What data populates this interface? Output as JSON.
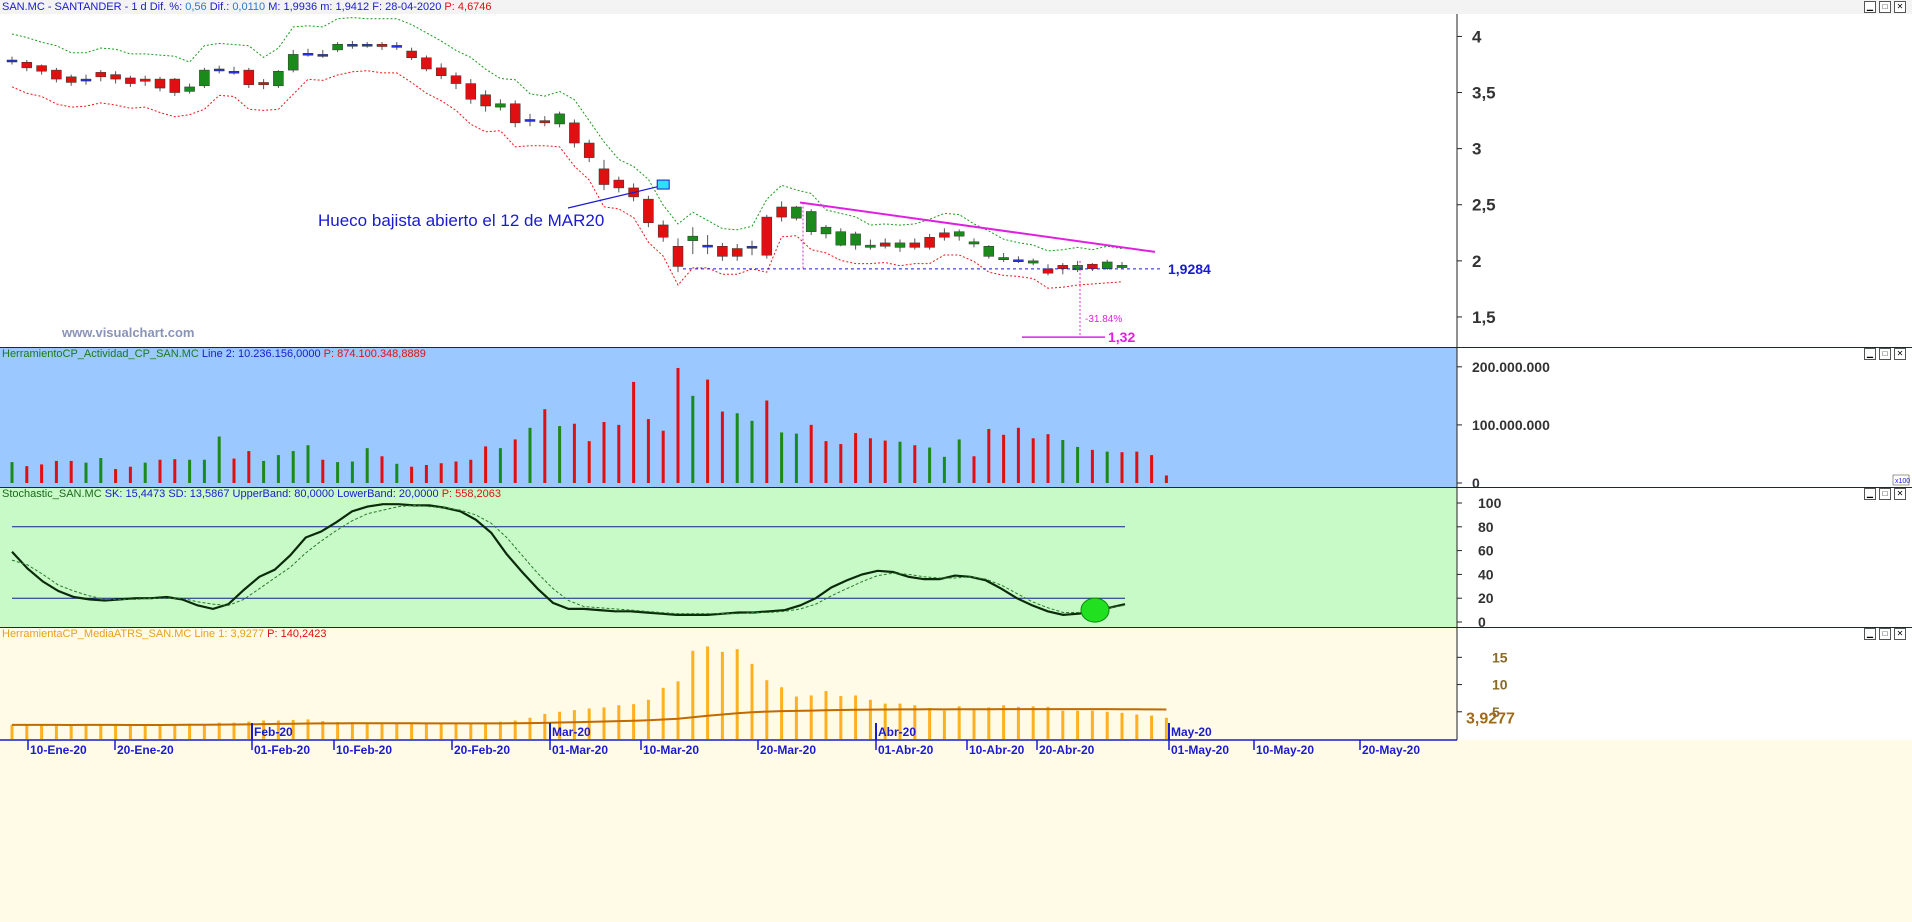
{
  "price_panel": {
    "ticker": "SAN.MC - SANTANDER -",
    "period": "1 d",
    "dif_pct_label": "Dif. %:",
    "dif_pct_value": "0,56",
    "dif_label": "Dif.:",
    "dif_value": "0,0110",
    "max_label": "M:",
    "max_value": "1,9936",
    "min_label": "m:",
    "min_value": "1,9412",
    "date_label": "F:",
    "date_value": "28-04-2020",
    "p_label": "P:",
    "p_value": "4,6746",
    "annotation": "Hueco bajista abierto el 12 de MAR20",
    "support_label": "1,9284",
    "target_label": "1,32",
    "drop_pct_label": "-31.84%",
    "watermark": "www.visualchart.com",
    "y_ticks": [
      "4",
      "3,5",
      "3",
      "2,5",
      "2",
      "1,5"
    ]
  },
  "volume_panel": {
    "title_name": "HerramientoCP_Actividad_CP_SAN.MC",
    "line_label": "Line 2:",
    "line_value": "10.236.156,0000",
    "p_text": "P: 874.100.348,8889",
    "y_ticks": [
      "200.000.000",
      "100.000.000",
      "0"
    ],
    "scale_tag": "x100"
  },
  "stoch_panel": {
    "title_name": "Stochastic_SAN.MC",
    "params": "SK: 15,4473  SD: 13,5867  UpperBand: 80,0000  LowerBand: 20,0000",
    "p_text": "P: 558,2063",
    "y_ticks": [
      "100",
      "80",
      "60",
      "40",
      "20",
      "0"
    ]
  },
  "atr_panel": {
    "title_name": "HerramientaCP_MediaATRS_SAN.MC",
    "params": "Line 1: 3,9277",
    "p_text": "P: 140,2423",
    "y_ticks": [
      "15",
      "10",
      "5"
    ],
    "value_label": "3,9277"
  },
  "x_axis": {
    "month_labels": [
      "Feb-20",
      "Mar-20",
      "Abr-20",
      "May-20"
    ],
    "date_labels": [
      "10-Ene-20",
      "20-Ene-20",
      "01-Feb-20",
      "10-Feb-20",
      "20-Feb-20",
      "01-Mar-20",
      "10-Mar-20",
      "20-Mar-20",
      "01-Abr-20",
      "10-Abr-20",
      "20-Abr-20",
      "01-May-20",
      "10-May-20",
      "20-May-20"
    ]
  },
  "colors": {
    "bull": "#1a8a1a",
    "bear": "#e01010",
    "neutral": "#2233dd",
    "channel_upper": "#1a9a1a",
    "channel_lower": "#e81818",
    "trendline": "#e020e0",
    "annotation": "#1a1ad0",
    "volume_bg": "#9ac8ff",
    "stoch_bg": "#c8fac8",
    "atr_bg": "#fffbe6",
    "atr_bar": "#ffb020",
    "atr_line": "#c06a00"
  },
  "chart_data": [
    {
      "type": "candlestick",
      "title": "SAN.MC - SANTANDER - 1 d",
      "ylim": [
        1.25,
        4.2
      ],
      "dates": [
        "2020-01-02",
        "2020-01-03",
        "2020-01-06",
        "2020-01-07",
        "2020-01-08",
        "2020-01-09",
        "2020-01-10",
        "2020-01-13",
        "2020-01-14",
        "2020-01-15",
        "2020-01-16",
        "2020-01-17",
        "2020-01-20",
        "2020-01-21",
        "2020-01-22",
        "2020-01-23",
        "2020-01-24",
        "2020-01-27",
        "2020-01-28",
        "2020-01-29",
        "2020-01-30",
        "2020-01-31",
        "2020-02-03",
        "2020-02-04",
        "2020-02-05",
        "2020-02-06",
        "2020-02-07",
        "2020-02-10",
        "2020-02-11",
        "2020-02-12",
        "2020-02-13",
        "2020-02-14",
        "2020-02-17",
        "2020-02-18",
        "2020-02-19",
        "2020-02-20",
        "2020-02-21",
        "2020-02-24",
        "2020-02-25",
        "2020-02-26",
        "2020-02-27",
        "2020-02-28",
        "2020-03-02",
        "2020-03-03",
        "2020-03-04",
        "2020-03-05",
        "2020-03-06",
        "2020-03-09",
        "2020-03-10",
        "2020-03-11",
        "2020-03-12",
        "2020-03-13",
        "2020-03-16",
        "2020-03-17",
        "2020-03-18",
        "2020-03-19",
        "2020-03-20",
        "2020-03-23",
        "2020-03-24",
        "2020-03-25",
        "2020-03-26",
        "2020-03-27",
        "2020-03-30",
        "2020-03-31",
        "2020-04-01",
        "2020-04-02",
        "2020-04-03",
        "2020-04-06",
        "2020-04-07",
        "2020-04-08",
        "2020-04-09",
        "2020-04-14",
        "2020-04-15",
        "2020-04-16",
        "2020-04-17",
        "2020-04-20",
        "2020-04-21",
        "2020-04-22",
        "2020-04-23",
        "2020-04-24",
        "2020-04-27",
        "2020-04-28"
      ],
      "open": [
        3.79,
        3.77,
        3.74,
        3.7,
        3.64,
        3.62,
        3.68,
        3.66,
        3.63,
        3.62,
        3.62,
        3.62,
        3.51,
        3.56,
        3.71,
        3.69,
        3.7,
        3.59,
        3.56,
        3.7,
        3.85,
        3.84,
        3.88,
        3.92,
        3.92,
        3.93,
        3.91,
        3.87,
        3.81,
        3.72,
        3.65,
        3.58,
        3.48,
        3.37,
        3.4,
        3.26,
        3.25,
        3.22,
        3.23,
        3.05,
        2.82,
        2.72,
        2.65,
        2.55,
        2.32,
        2.13,
        2.18,
        2.14,
        2.13,
        2.11,
        2.13,
        2.39,
        2.48,
        2.38,
        2.26,
        2.24,
        2.14,
        2.14,
        2.12,
        2.16,
        2.12,
        2.16,
        2.21,
        2.25,
        2.22,
        2.15,
        2.04,
        2.01,
        2.0,
        1.98,
        1.93,
        1.96,
        1.92,
        1.97,
        1.93,
        1.94
      ],
      "close": [
        3.79,
        3.72,
        3.69,
        3.62,
        3.59,
        3.62,
        3.64,
        3.62,
        3.58,
        3.6,
        3.54,
        3.5,
        3.55,
        3.7,
        3.7,
        3.69,
        3.57,
        3.57,
        3.69,
        3.84,
        3.85,
        3.84,
        3.93,
        3.93,
        3.93,
        3.91,
        3.92,
        3.81,
        3.71,
        3.65,
        3.58,
        3.44,
        3.38,
        3.4,
        3.23,
        3.25,
        3.23,
        3.31,
        3.05,
        2.92,
        2.68,
        2.65,
        2.57,
        2.34,
        2.21,
        1.95,
        2.22,
        2.13,
        2.04,
        2.04,
        2.13,
        2.05,
        2.39,
        2.48,
        2.44,
        2.3,
        2.26,
        2.24,
        2.14,
        2.13,
        2.16,
        2.12,
        2.12,
        2.21,
        2.26,
        2.17,
        2.13,
        2.03,
        2.01,
        2.0,
        1.89,
        1.93,
        1.96,
        1.93,
        1.99,
        1.96
      ],
      "high": [
        3.82,
        3.79,
        3.75,
        3.72,
        3.66,
        3.66,
        3.7,
        3.69,
        3.65,
        3.65,
        3.64,
        3.63,
        3.58,
        3.72,
        3.74,
        3.73,
        3.72,
        3.62,
        3.7,
        3.88,
        3.89,
        3.88,
        3.95,
        3.96,
        3.95,
        3.95,
        3.95,
        3.9,
        3.83,
        3.76,
        3.68,
        3.62,
        3.52,
        3.44,
        3.43,
        3.31,
        3.29,
        3.33,
        3.26,
        3.08,
        2.9,
        2.75,
        2.69,
        2.58,
        2.36,
        2.2,
        2.3,
        2.23,
        2.16,
        2.15,
        2.18,
        2.41,
        2.53,
        2.49,
        2.46,
        2.32,
        2.29,
        2.26,
        2.19,
        2.2,
        2.19,
        2.2,
        2.24,
        2.29,
        2.28,
        2.2,
        2.14,
        2.07,
        2.04,
        2.02,
        1.97,
        1.98,
        2.0,
        1.98,
        2.01,
        1.99
      ],
      "low": [
        3.75,
        3.69,
        3.66,
        3.59,
        3.56,
        3.57,
        3.6,
        3.58,
        3.55,
        3.56,
        3.51,
        3.47,
        3.49,
        3.54,
        3.67,
        3.66,
        3.54,
        3.53,
        3.54,
        3.68,
        3.82,
        3.81,
        3.86,
        3.89,
        3.9,
        3.88,
        3.88,
        3.79,
        3.69,
        3.62,
        3.53,
        3.4,
        3.33,
        3.34,
        3.19,
        3.2,
        3.2,
        3.19,
        3.01,
        2.88,
        2.63,
        2.61,
        2.53,
        2.3,
        2.17,
        1.9,
        2.06,
        2.06,
        2.0,
        2.0,
        2.05,
        2.02,
        2.35,
        2.36,
        2.23,
        2.2,
        2.13,
        2.1,
        2.1,
        2.11,
        2.08,
        2.1,
        2.1,
        2.18,
        2.18,
        2.12,
        2.02,
        1.99,
        1.98,
        1.96,
        1.87,
        1.88,
        1.9,
        1.91,
        1.92,
        1.93
      ],
      "support": 1.9284,
      "target": 1.32,
      "annotation": "Hueco bajista abierto el 12 de MAR20"
    },
    {
      "type": "bar",
      "title": "HerramientoCP_Actividad_CP_SAN.MC",
      "ylim": [
        0,
        210000000
      ],
      "values": [
        36000000,
        29000000,
        32000000,
        38000000,
        38000000,
        35000000,
        43000000,
        24000000,
        28000000,
        35000000,
        40000000,
        41000000,
        40000000,
        40000000,
        80000000,
        42000000,
        55000000,
        38000000,
        48000000,
        55000000,
        65000000,
        40000000,
        36000000,
        37000000,
        60000000,
        46000000,
        33000000,
        28000000,
        31000000,
        34000000,
        37000000,
        40000000,
        63000000,
        60000000,
        75000000,
        95000000,
        127000000,
        98000000,
        102000000,
        72000000,
        105000000,
        100000000,
        174000000,
        110000000,
        90000000,
        198000000,
        150000000,
        178000000,
        123000000,
        120000000,
        107000000,
        142000000,
        87000000,
        85000000,
        100000000,
        72000000,
        67000000,
        86000000,
        77000000,
        73000000,
        71000000,
        65000000,
        61000000,
        45000000,
        75000000,
        46000000,
        93000000,
        83000000,
        95000000,
        77000000,
        84000000,
        74000000,
        62000000,
        57000000,
        54000000,
        53000000,
        54000000,
        48000000,
        13000000
      ]
    },
    {
      "type": "line",
      "title": "Stochastic_SAN.MC",
      "ylim": [
        0,
        100
      ],
      "series": [
        {
          "name": "SK",
          "values": [
            59,
            45,
            34,
            26,
            21,
            19,
            18,
            19,
            20,
            20,
            21,
            19,
            14,
            11,
            15,
            27,
            38,
            44,
            56,
            71,
            76,
            84,
            93,
            97,
            99,
            99,
            98,
            98,
            96,
            93,
            86,
            75,
            57,
            42,
            28,
            16,
            11,
            11,
            10,
            9,
            9,
            8,
            7,
            6,
            6,
            6,
            7,
            8,
            8,
            9,
            10,
            14,
            20,
            29,
            35,
            40,
            43,
            42,
            38,
            36,
            36,
            39,
            38,
            35,
            28,
            20,
            14,
            9,
            6,
            7,
            9,
            12,
            15
          ]
        },
        {
          "name": "SD",
          "values": [
            52,
            48,
            40,
            31,
            26,
            22,
            19,
            19,
            19,
            20,
            20,
            20,
            17,
            15,
            14,
            19,
            28,
            37,
            46,
            58,
            68,
            77,
            85,
            91,
            94,
            97,
            98,
            97,
            96,
            94,
            90,
            83,
            71,
            56,
            41,
            28,
            18,
            13,
            12,
            11,
            10,
            9,
            8,
            7,
            7,
            7,
            7,
            7,
            8,
            8,
            9,
            11,
            15,
            22,
            28,
            34,
            39,
            41,
            40,
            38,
            37,
            37,
            38,
            36,
            31,
            24,
            17,
            12,
            8,
            8,
            10,
            12,
            14
          ]
        }
      ],
      "upper_band": 80,
      "lower_band": 20
    },
    {
      "type": "bar",
      "title": "HerramientaCP_MediaATRS_SAN.MC",
      "ylim": [
        0,
        18
      ],
      "values": [
        2.6,
        2.6,
        2.6,
        2.6,
        2.5,
        2.6,
        2.6,
        2.6,
        2.5,
        2.6,
        2.6,
        2.7,
        2.8,
        2.7,
        3.0,
        3.0,
        3.2,
        3.4,
        3.4,
        3.5,
        3.6,
        3.3,
        3.1,
        3.1,
        3.0,
        2.9,
        2.8,
        2.8,
        2.8,
        2.8,
        2.8,
        2.8,
        2.8,
        3.2,
        3.4,
        3.9,
        4.6,
        5.0,
        5.3,
        5.6,
        5.8,
        6.2,
        6.4,
        7.2,
        9.4,
        10.6,
        16.2,
        17.0,
        16.0,
        16.5,
        13.8,
        10.8,
        9.5,
        7.8,
        8.0,
        8.8,
        7.9,
        8.0,
        7.2,
        6.5,
        6.5,
        6.2,
        5.7,
        5.2,
        6.0,
        5.5,
        5.8,
        6.2,
        5.9,
        6.0,
        5.9,
        5.2,
        5.2,
        5.2,
        5.0,
        4.8,
        4.5,
        4.3,
        3.9
      ],
      "line_value": 3.9277
    }
  ]
}
